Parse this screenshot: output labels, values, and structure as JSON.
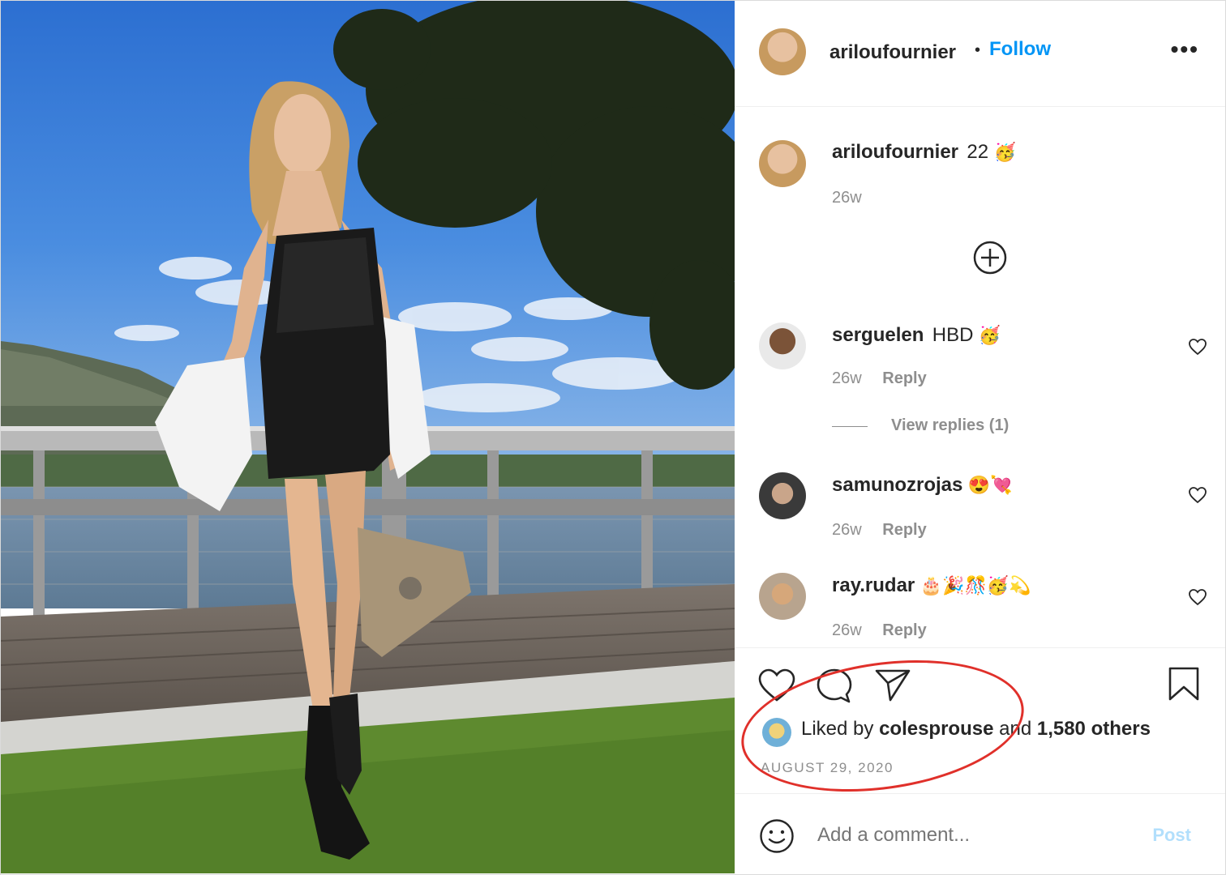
{
  "post": {
    "author": "ariloufournier",
    "follow_label": "Follow",
    "separator": "•",
    "more_label": "•••"
  },
  "caption": {
    "username": "ariloufournier",
    "text": "22",
    "emoji": "🥳",
    "time": "26w"
  },
  "load_more_icon": "plus-circle-icon",
  "comments": [
    {
      "username": "serguelen",
      "text": "HBD",
      "emoji": "🥳",
      "time": "26w",
      "reply": "Reply",
      "view_replies": "View replies (1)"
    },
    {
      "username": "samunozrojas",
      "text": "",
      "emoji": "😍💘",
      "time": "26w",
      "reply": "Reply"
    },
    {
      "username": "ray.rudar",
      "text": "",
      "emoji": "🎂🎉🎊🥳💫",
      "time": "26w",
      "reply": "Reply"
    }
  ],
  "likes": {
    "prefix": "Liked by",
    "user": "colesprouse",
    "middle": "and",
    "others": "1,580 others"
  },
  "date": "AUGUST 29, 2020",
  "comment_input": {
    "placeholder": "Add a comment...",
    "post_label": "Post"
  },
  "colors": {
    "link": "#0095f6",
    "secondary": "#8e8e8e",
    "annotation": "#e0302a",
    "post_disabled": "#b2dffc"
  }
}
